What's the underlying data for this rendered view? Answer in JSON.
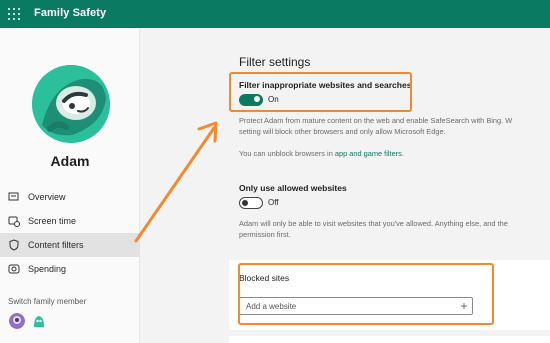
{
  "app": {
    "title": "Family Safety"
  },
  "profile": {
    "name": "Adam"
  },
  "sidebar": {
    "items": [
      {
        "label": "Overview",
        "icon": "overview-icon"
      },
      {
        "label": "Screen time",
        "icon": "screen-time-icon"
      },
      {
        "label": "Content filters",
        "icon": "shield-icon",
        "active": true
      },
      {
        "label": "Spending",
        "icon": "spending-icon"
      }
    ],
    "switch_label": "Switch family member"
  },
  "filter": {
    "section_title": "Filter settings",
    "inappropriate": {
      "title": "Filter inappropriate websites and searches",
      "state_label": "On",
      "description_line1": "Protect Adam from mature content on the web and enable SafeSearch with Bing. W",
      "description_line2": "setting will block other browsers and only allow Microsoft Edge.",
      "unblock_prefix": "You can unblock browsers in ",
      "unblock_link": "app and game filters",
      "unblock_suffix": "."
    },
    "allowed_only": {
      "title": "Only use allowed websites",
      "state_label": "Off",
      "description_line1": "Adam will only be able to visit websites that you've allowed. Anything else, and the",
      "description_line2": "permission first."
    }
  },
  "blocked": {
    "title": "Blocked sites",
    "placeholder": "Add a website",
    "add_symbol": "+"
  },
  "colors": {
    "brand": "#0b7a63",
    "highlight": "#f28a2f",
    "avatar": "#2bbf9c"
  }
}
